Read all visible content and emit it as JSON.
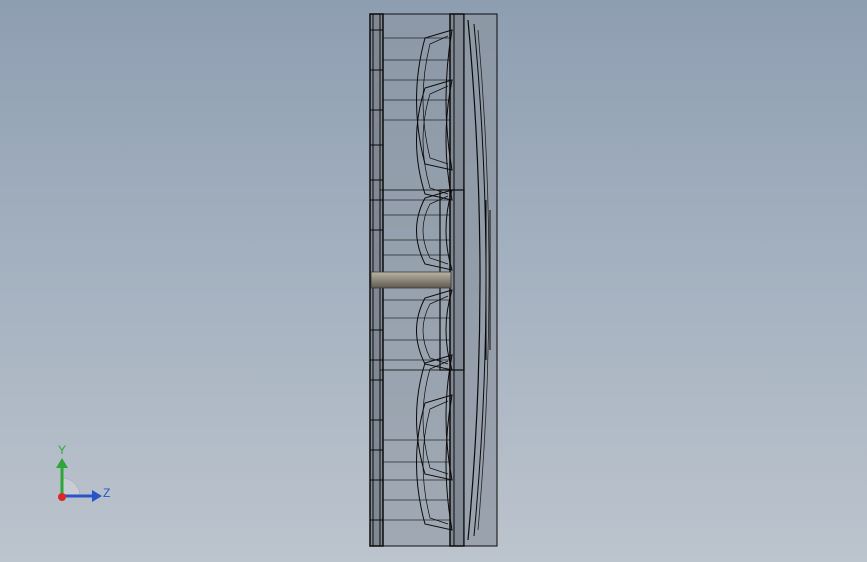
{
  "viewport": {
    "background_top": "#8e9eb1",
    "background_bottom": "#bcc4cd"
  },
  "model": {
    "view": "side",
    "display_mode": "shaded-with-edges",
    "body_color": "#8f98a3",
    "edge_color": "#0a0a0a"
  },
  "triad": {
    "y_label": "Y",
    "z_label": "Z",
    "y_color": "#2fa63a",
    "z_color": "#2a53c9",
    "x_color": "#d8282a"
  }
}
